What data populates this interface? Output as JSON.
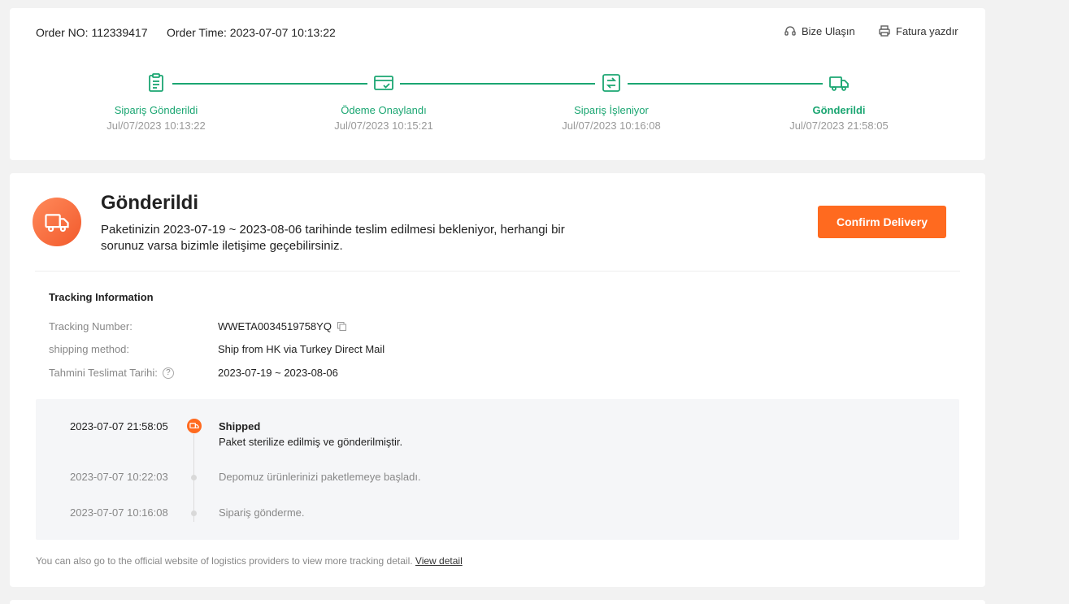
{
  "order": {
    "order_no": "Order NO: 112339417",
    "order_time": "Order Time: 2023-07-07 10:13:22"
  },
  "links": {
    "contact": "Bize Ulaşın",
    "contact_icon": "headset-icon",
    "invoice": "Fatura yazdır",
    "invoice_icon": "printer-icon"
  },
  "steps": [
    {
      "title": "Sipariş Gönderildi",
      "time": "Jul/07/2023 10:13:22",
      "icon": "clipboard-icon"
    },
    {
      "title": "Ödeme Onaylandı",
      "time": "Jul/07/2023 10:15:21",
      "icon": "card-check-icon"
    },
    {
      "title": "Sipariş İşleniyor",
      "time": "Jul/07/2023 10:16:08",
      "icon": "processing-icon"
    },
    {
      "title": "Gönderildi",
      "time": "Jul/07/2023 21:58:05",
      "icon": "truck-icon"
    }
  ],
  "status": {
    "title": "Gönderildi",
    "description": "Paketinizin 2023-07-19 ~ 2023-08-06 tarihinde teslim edilmesi bekleniyor, herhangi bir sorunuz varsa bizimle iletişime geçebilirsiniz.",
    "confirm_label": "Confirm Delivery",
    "icon": "truck-icon"
  },
  "tracking": {
    "heading": "Tracking Information",
    "rows": [
      {
        "label": "Tracking Number:",
        "value": "WWETA0034519758YQ"
      },
      {
        "label": "shipping method:",
        "value": "Ship from HK via Turkey Direct Mail"
      },
      {
        "label": "Tahmini Teslimat Tarihi:",
        "value": "2023-07-19 ~ 2023-08-06"
      }
    ],
    "events": [
      {
        "time": "2023-07-07 21:58:05",
        "title": "Shipped",
        "desc": "Paket sterilize edilmiş ve gönderilmiştir."
      },
      {
        "time": "2023-07-07 10:22:03",
        "desc": "Depomuz ürünlerinizi paketlemeye başladı."
      },
      {
        "time": "2023-07-07 10:16:08",
        "desc": "Sipariş gönderme."
      }
    ]
  },
  "footer": {
    "note": "You can also go to the official website of logistics providers to view more tracking detail.",
    "link": "View detail"
  },
  "colors": {
    "accent_green": "#1ba672",
    "accent_orange": "#ff6a1f"
  }
}
